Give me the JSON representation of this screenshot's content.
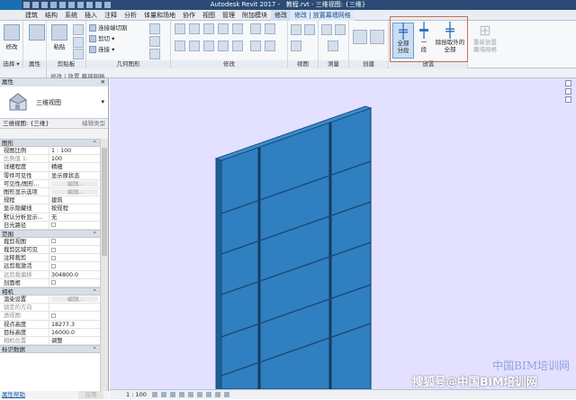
{
  "title_bar": {
    "app_title": "Autodesk Revit 2017 -",
    "file_title": "教程.rvt - 三维视图: {三维}"
  },
  "menu": {
    "items": [
      {
        "label": "建筑"
      },
      {
        "label": "结构"
      },
      {
        "label": "系统"
      },
      {
        "label": "插入"
      },
      {
        "label": "注释"
      },
      {
        "label": "分析"
      },
      {
        "label": "体量和场地"
      },
      {
        "label": "协作"
      },
      {
        "label": "视图"
      },
      {
        "label": "管理"
      },
      {
        "label": "附加模块"
      },
      {
        "label": "修改"
      },
      {
        "label": "修改 | 放置幕墙网格"
      }
    ]
  },
  "ribbon": {
    "select_panel": {
      "modify": "修改",
      "label": "选择 ▾"
    },
    "properties_panel": {
      "label": "属性"
    },
    "clipboard": {
      "paste": "粘贴",
      "cut_label": "剪切",
      "join_label": "连接",
      "label": "剪贴板"
    },
    "geometry": {
      "cope": "连接端切割",
      "cut": "剪切 ▾",
      "join": "连接 ▾",
      "label": "几何图形"
    },
    "modify": {
      "label": "修改"
    },
    "view": {
      "label": "视图"
    },
    "measure": {
      "label": "测量"
    },
    "create": {
      "label": "创建"
    },
    "placement": {
      "label": "放置",
      "all_segments": "全部\n分段",
      "one_segment": "一\n段",
      "all_except": "除拾取外的\n全部"
    },
    "regrid": {
      "label": "重新放置\n幕墙网格"
    },
    "context_footer": "修改 | 放置 幕墙网格"
  },
  "properties": {
    "header": "属性",
    "type_name": "三维视图",
    "view_label": "三维视图: {三维}",
    "edit_type": "编辑类型",
    "apply": "应用",
    "help": "属性帮助",
    "categories": [
      {
        "name": "图形",
        "rows": [
          {
            "key": "视图比例",
            "value": "1 : 100"
          },
          {
            "key": "比例值 1:",
            "value": "100",
            "grey": true
          },
          {
            "key": "详细程度",
            "value": "精细"
          },
          {
            "key": "零件可见性",
            "value": "显示原状态"
          },
          {
            "key": "可见性/图形...",
            "value": "编辑...",
            "button": true
          },
          {
            "key": "图形显示选项",
            "value": "编辑...",
            "button": true
          },
          {
            "key": "规程",
            "value": "建筑"
          },
          {
            "key": "显示隐藏线",
            "value": "按规程"
          },
          {
            "key": "默认分析显示...",
            "value": "无"
          },
          {
            "key": "日光路径",
            "value": "",
            "checkbox": true
          }
        ]
      },
      {
        "name": "范围",
        "rows": [
          {
            "key": "裁剪视图",
            "value": "",
            "checkbox": true
          },
          {
            "key": "裁剪区域可见",
            "value": "",
            "checkbox": true
          },
          {
            "key": "注释裁剪",
            "value": "",
            "checkbox": true
          },
          {
            "key": "远剪裁激活",
            "value": "",
            "checkbox": true
          },
          {
            "key": "远剪裁偏移",
            "value": "304800.0",
            "grey": true
          },
          {
            "key": "剖面框",
            "value": "",
            "checkbox": true
          }
        ]
      },
      {
        "name": "相机",
        "rows": [
          {
            "key": "渲染设置",
            "value": "编辑...",
            "button": true
          },
          {
            "key": "锁定的方向",
            "value": "",
            "grey": true
          },
          {
            "key": "透视图",
            "value": "",
            "checkbox": true,
            "grey": true
          },
          {
            "key": "视点高度",
            "value": "18277.3"
          },
          {
            "key": "目标高度",
            "value": "16000.0"
          },
          {
            "key": "相机位置",
            "value": "调整",
            "grey": true
          }
        ]
      },
      {
        "name": "标识数据",
        "rows": []
      }
    ]
  },
  "status_bar": {
    "scale": "1 : 100"
  },
  "watermark": {
    "text": "搜狐号@中国BIM培训网",
    "faint": "中国BIM培训网"
  },
  "colors": {
    "viewport_bg": "#e3e1ff",
    "wall_face": "#2f7fc1",
    "wall_edge": "#1e4f7d",
    "highlight_border": "#c07257"
  }
}
